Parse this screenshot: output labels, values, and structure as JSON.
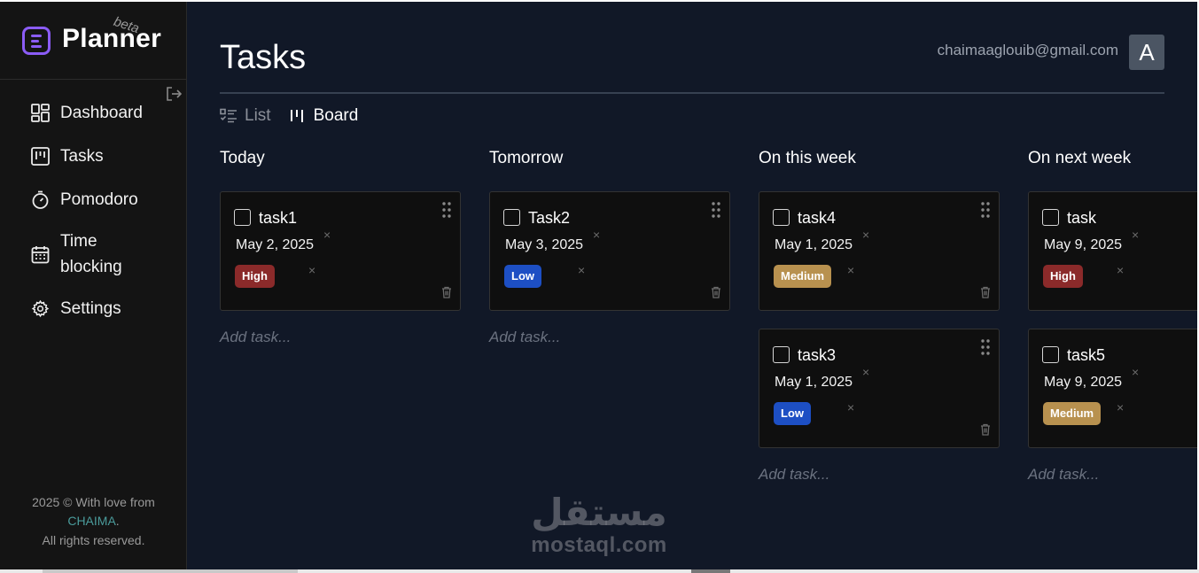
{
  "brand": {
    "name": "Planner",
    "tag": "beta"
  },
  "sidebar": {
    "items": [
      {
        "label": "Dashboard",
        "icon": "dashboard-icon"
      },
      {
        "label": "Tasks",
        "icon": "kanban-icon"
      },
      {
        "label": "Pomodoro",
        "icon": "timer-icon"
      },
      {
        "label": "Time blocking",
        "icon": "calendar-icon"
      },
      {
        "label": "Settings",
        "icon": "gear-icon"
      }
    ],
    "footer": {
      "line1": "2025 © With love from",
      "author": "CHAIMA",
      "period": ".",
      "line2": "All rights reserved."
    }
  },
  "header": {
    "title": "Tasks",
    "user_email": "chaimaaglouib@gmail.com",
    "avatar_letter": "A"
  },
  "view_switch": {
    "list_label": "List",
    "board_label": "Board",
    "active": "Board"
  },
  "columns": [
    {
      "title": "Today",
      "tasks": [
        {
          "name": "task1",
          "date": "May 2, 2025",
          "priority": "High"
        }
      ],
      "add_label": "Add task..."
    },
    {
      "title": "Tomorrow",
      "tasks": [
        {
          "name": "Task2",
          "date": "May 3, 2025",
          "priority": "Low"
        }
      ],
      "add_label": "Add task..."
    },
    {
      "title": "On this week",
      "tasks": [
        {
          "name": "task4",
          "date": "May 1, 2025",
          "priority": "Medium"
        },
        {
          "name": "task3",
          "date": "May 1, 2025",
          "priority": "Low"
        }
      ],
      "add_label": "Add task..."
    },
    {
      "title": "On next week",
      "tasks": [
        {
          "name": "task",
          "date": "May 9, 2025",
          "priority": "High"
        },
        {
          "name": "task5",
          "date": "May 9, 2025",
          "priority": "Medium"
        }
      ],
      "add_label": "Add task..."
    }
  ],
  "card_controls": {
    "remove_glyph": "×"
  },
  "priority_colors": {
    "High": "#8b2a2a",
    "Low": "#1d4fc4",
    "Medium": "#b8914f"
  },
  "colors": {
    "accent": "#8b5cf6",
    "sidebar_bg": "#141414",
    "main_bg": "#111827",
    "card_bg": "#0f0f0f"
  },
  "watermark": {
    "arabic": "مستقل",
    "latin": "mostaql.com"
  }
}
